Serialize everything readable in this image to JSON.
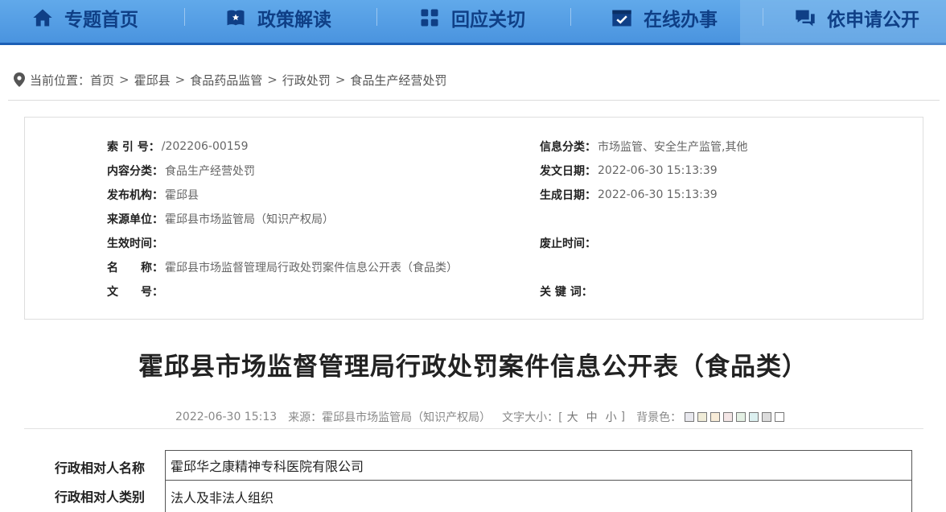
{
  "nav": {
    "items": [
      {
        "label": "专题首页",
        "icon": "home-icon"
      },
      {
        "label": "政策解读",
        "icon": "book-icon"
      },
      {
        "label": "回应关切",
        "icon": "grid-icon"
      },
      {
        "label": "在线办事",
        "icon": "checklist-icon"
      },
      {
        "label": "依申请公开",
        "icon": "chat-icon"
      }
    ],
    "colors": {
      "bar": "#4a94df",
      "text": "#0f3f86",
      "border": "#1c5fb5"
    }
  },
  "breadcrumb": {
    "prefix": "当前位置：",
    "items": [
      "首页",
      "霍邱县",
      "食品药品监管",
      "行政处罚",
      "食品生产经营处罚"
    ],
    "separator": ">"
  },
  "meta": {
    "left": [
      {
        "key": "索 引 号：",
        "value": "/202206-00159"
      },
      {
        "key": "内容分类：",
        "value": "食品生产经营处罚"
      },
      {
        "key": "发布机构：",
        "value": "霍邱县"
      },
      {
        "key": "来源单位：",
        "value": "霍邱县市场监管局（知识产权局）"
      },
      {
        "key": "生效时间：",
        "value": ""
      },
      {
        "key": "名　　称：",
        "value": "霍邱县市场监督管理局行政处罚案件信息公开表（食品类）"
      },
      {
        "key": "文　　号：",
        "value": ""
      }
    ],
    "right": [
      {
        "key": "信息分类：",
        "value": "市场监管、安全生产监管,其他"
      },
      {
        "key": "发文日期：",
        "value": "2022-06-30 15:13:39"
      },
      {
        "key": "生成日期：",
        "value": "2022-06-30 15:13:39"
      },
      {
        "key": "",
        "value": ""
      },
      {
        "key": "废止时间：",
        "value": ""
      },
      {
        "key": "",
        "value": ""
      },
      {
        "key": "关 键 词：",
        "value": ""
      }
    ]
  },
  "article": {
    "title": "霍邱县市场监督管理局行政处罚案件信息公开表（食品类）",
    "date": "2022-06-30 15:13",
    "source": "来源：霍邱县市场监管局（知识产权局）",
    "font_size_label": "文字大小：[",
    "font_sizes": [
      "大",
      "中",
      "小"
    ],
    "font_size_close": "]",
    "bg_label": "背景色：",
    "bg_colors": [
      "#e8e8ee",
      "#f0ecd8",
      "#f8ecd8",
      "#f4e6e6",
      "#e4f0e4",
      "#dcf0f0",
      "#dcdcdc",
      "#ffffff"
    ]
  },
  "table": {
    "rows": [
      {
        "label": "行政相对人名称",
        "value": "霍邱华之康精神专科医院有限公司"
      },
      {
        "label": "行政相对人类别",
        "value": "法人及非法人组织"
      }
    ]
  }
}
